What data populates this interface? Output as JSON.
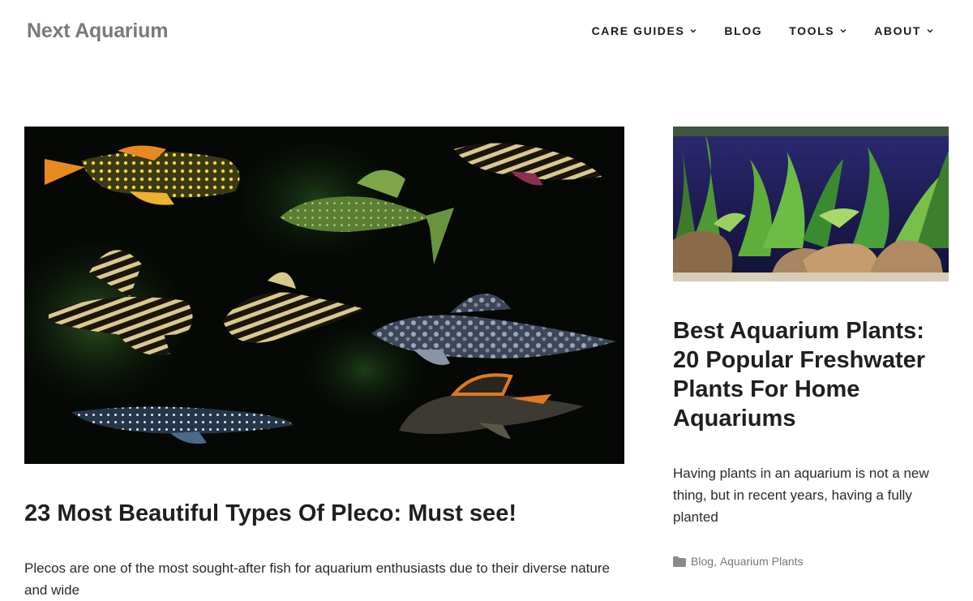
{
  "site": {
    "title": "Next Aquarium"
  },
  "nav": {
    "items": [
      {
        "label": "CARE GUIDES",
        "has_dropdown": true
      },
      {
        "label": "BLOG",
        "has_dropdown": false
      },
      {
        "label": "TOOLS",
        "has_dropdown": true
      },
      {
        "label": "ABOUT",
        "has_dropdown": true
      }
    ]
  },
  "main_post": {
    "image_icon": "pleco-fish-collage-image",
    "title": "23 Most Beautiful Types Of Pleco: Must see!",
    "excerpt": "Plecos are one of the most sought-after fish for aquarium enthusiasts due to their diverse nature and wide"
  },
  "side_post": {
    "image_icon": "planted-aquarium-image",
    "title": "Best Aquarium Plants: 20 Popular Freshwater Plants For Home Aquariums",
    "excerpt": "Having plants in an aquarium is not a new thing, but in recent years, having a fully planted",
    "meta": {
      "icon": "folder-icon",
      "category_1": "Blog",
      "separator": ", ",
      "category_2": "Aquarium Plants"
    }
  },
  "colors": {
    "site_title": "#7a7a7a",
    "nav_text": "#1a1a1a",
    "heading": "#1f1f1f",
    "body_text": "#2a2a2a",
    "meta_text": "#777777"
  }
}
